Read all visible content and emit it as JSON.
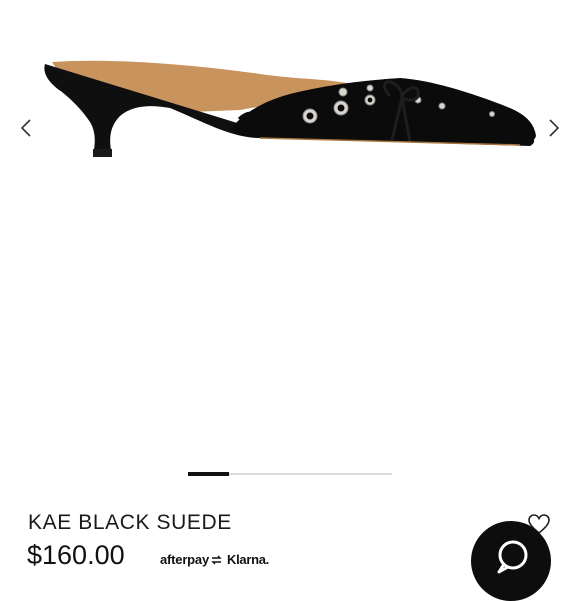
{
  "product": {
    "name": "KAE BLACK SUEDE",
    "price": "$160.00",
    "image_icon": "kitten-heel-mule-shoe"
  },
  "gallery": {
    "prev_icon": "chevron-left-icon",
    "next_icon": "chevron-right-icon",
    "progress_fraction": 0.2
  },
  "payments": {
    "afterpay": "afterpay",
    "klarna": "Klarna."
  },
  "actions": {
    "wishlist_icon": "heart-icon",
    "chat_icon": "chat-bubble-icon"
  },
  "colors": {
    "accent": "#111111",
    "chat_button": "#0d0d0d",
    "track": "#dddddd"
  }
}
